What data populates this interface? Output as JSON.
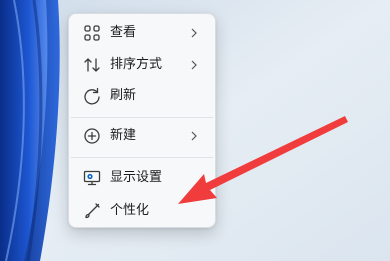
{
  "context_menu": {
    "items": [
      {
        "label": "查看",
        "icon": "grid-view-icon",
        "has_submenu": true
      },
      {
        "label": "排序方式",
        "icon": "sort-arrows-icon",
        "has_submenu": true
      },
      {
        "label": "刷新",
        "icon": "refresh-icon",
        "has_submenu": false
      },
      {
        "label": "新建",
        "icon": "new-plus-circle-icon",
        "has_submenu": true
      },
      {
        "label": "显示设置",
        "icon": "display-settings-icon",
        "has_submenu": false
      },
      {
        "label": "个性化",
        "icon": "personalize-brush-icon",
        "has_submenu": false
      }
    ]
  },
  "colors": {
    "menu_background": "#f7f8fa",
    "text": "#1b1b1b",
    "icon": "#3c3c3c",
    "display_icon_accent": "#0a64c8",
    "annotation_arrow": "#f03c3c",
    "wallpaper_blue": "#0b3fa8"
  }
}
